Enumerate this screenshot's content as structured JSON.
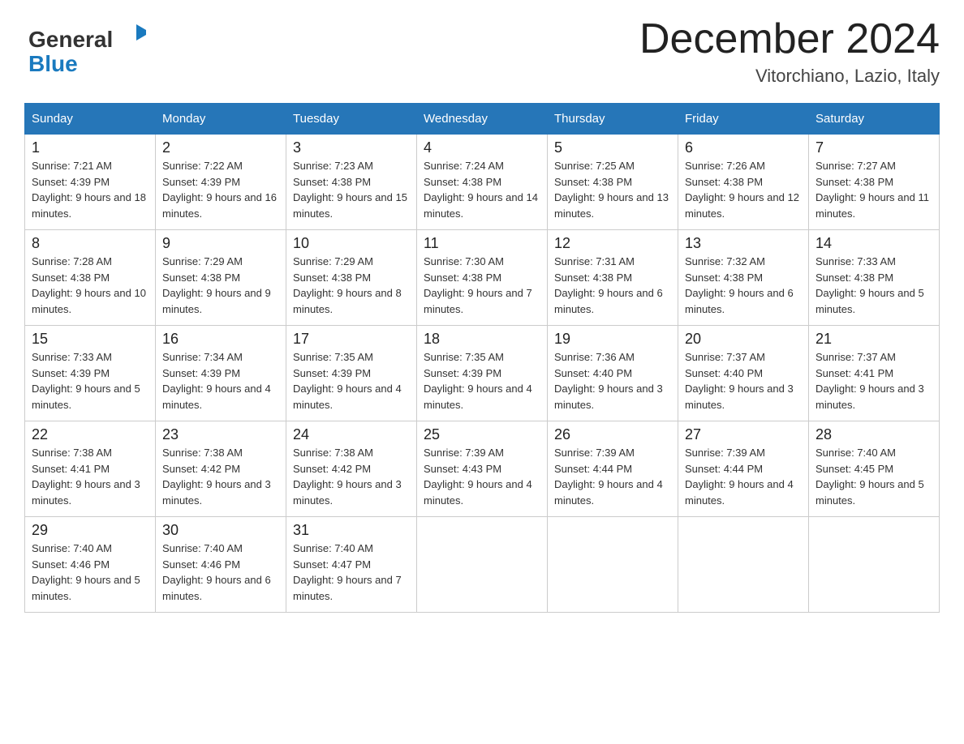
{
  "header": {
    "logo_text_general": "General",
    "logo_text_blue": "Blue",
    "month_title": "December 2024",
    "location": "Vitorchiano, Lazio, Italy"
  },
  "days_of_week": [
    "Sunday",
    "Monday",
    "Tuesday",
    "Wednesday",
    "Thursday",
    "Friday",
    "Saturday"
  ],
  "weeks": [
    [
      {
        "day": "1",
        "sunrise": "7:21 AM",
        "sunset": "4:39 PM",
        "daylight": "9 hours and 18 minutes."
      },
      {
        "day": "2",
        "sunrise": "7:22 AM",
        "sunset": "4:39 PM",
        "daylight": "9 hours and 16 minutes."
      },
      {
        "day": "3",
        "sunrise": "7:23 AM",
        "sunset": "4:38 PM",
        "daylight": "9 hours and 15 minutes."
      },
      {
        "day": "4",
        "sunrise": "7:24 AM",
        "sunset": "4:38 PM",
        "daylight": "9 hours and 14 minutes."
      },
      {
        "day": "5",
        "sunrise": "7:25 AM",
        "sunset": "4:38 PM",
        "daylight": "9 hours and 13 minutes."
      },
      {
        "day": "6",
        "sunrise": "7:26 AM",
        "sunset": "4:38 PM",
        "daylight": "9 hours and 12 minutes."
      },
      {
        "day": "7",
        "sunrise": "7:27 AM",
        "sunset": "4:38 PM",
        "daylight": "9 hours and 11 minutes."
      }
    ],
    [
      {
        "day": "8",
        "sunrise": "7:28 AM",
        "sunset": "4:38 PM",
        "daylight": "9 hours and 10 minutes."
      },
      {
        "day": "9",
        "sunrise": "7:29 AM",
        "sunset": "4:38 PM",
        "daylight": "9 hours and 9 minutes."
      },
      {
        "day": "10",
        "sunrise": "7:29 AM",
        "sunset": "4:38 PM",
        "daylight": "9 hours and 8 minutes."
      },
      {
        "day": "11",
        "sunrise": "7:30 AM",
        "sunset": "4:38 PM",
        "daylight": "9 hours and 7 minutes."
      },
      {
        "day": "12",
        "sunrise": "7:31 AM",
        "sunset": "4:38 PM",
        "daylight": "9 hours and 6 minutes."
      },
      {
        "day": "13",
        "sunrise": "7:32 AM",
        "sunset": "4:38 PM",
        "daylight": "9 hours and 6 minutes."
      },
      {
        "day": "14",
        "sunrise": "7:33 AM",
        "sunset": "4:38 PM",
        "daylight": "9 hours and 5 minutes."
      }
    ],
    [
      {
        "day": "15",
        "sunrise": "7:33 AM",
        "sunset": "4:39 PM",
        "daylight": "9 hours and 5 minutes."
      },
      {
        "day": "16",
        "sunrise": "7:34 AM",
        "sunset": "4:39 PM",
        "daylight": "9 hours and 4 minutes."
      },
      {
        "day": "17",
        "sunrise": "7:35 AM",
        "sunset": "4:39 PM",
        "daylight": "9 hours and 4 minutes."
      },
      {
        "day": "18",
        "sunrise": "7:35 AM",
        "sunset": "4:39 PM",
        "daylight": "9 hours and 4 minutes."
      },
      {
        "day": "19",
        "sunrise": "7:36 AM",
        "sunset": "4:40 PM",
        "daylight": "9 hours and 3 minutes."
      },
      {
        "day": "20",
        "sunrise": "7:37 AM",
        "sunset": "4:40 PM",
        "daylight": "9 hours and 3 minutes."
      },
      {
        "day": "21",
        "sunrise": "7:37 AM",
        "sunset": "4:41 PM",
        "daylight": "9 hours and 3 minutes."
      }
    ],
    [
      {
        "day": "22",
        "sunrise": "7:38 AM",
        "sunset": "4:41 PM",
        "daylight": "9 hours and 3 minutes."
      },
      {
        "day": "23",
        "sunrise": "7:38 AM",
        "sunset": "4:42 PM",
        "daylight": "9 hours and 3 minutes."
      },
      {
        "day": "24",
        "sunrise": "7:38 AM",
        "sunset": "4:42 PM",
        "daylight": "9 hours and 3 minutes."
      },
      {
        "day": "25",
        "sunrise": "7:39 AM",
        "sunset": "4:43 PM",
        "daylight": "9 hours and 4 minutes."
      },
      {
        "day": "26",
        "sunrise": "7:39 AM",
        "sunset": "4:44 PM",
        "daylight": "9 hours and 4 minutes."
      },
      {
        "day": "27",
        "sunrise": "7:39 AM",
        "sunset": "4:44 PM",
        "daylight": "9 hours and 4 minutes."
      },
      {
        "day": "28",
        "sunrise": "7:40 AM",
        "sunset": "4:45 PM",
        "daylight": "9 hours and 5 minutes."
      }
    ],
    [
      {
        "day": "29",
        "sunrise": "7:40 AM",
        "sunset": "4:46 PM",
        "daylight": "9 hours and 5 minutes."
      },
      {
        "day": "30",
        "sunrise": "7:40 AM",
        "sunset": "4:46 PM",
        "daylight": "9 hours and 6 minutes."
      },
      {
        "day": "31",
        "sunrise": "7:40 AM",
        "sunset": "4:47 PM",
        "daylight": "9 hours and 7 minutes."
      },
      null,
      null,
      null,
      null
    ]
  ]
}
